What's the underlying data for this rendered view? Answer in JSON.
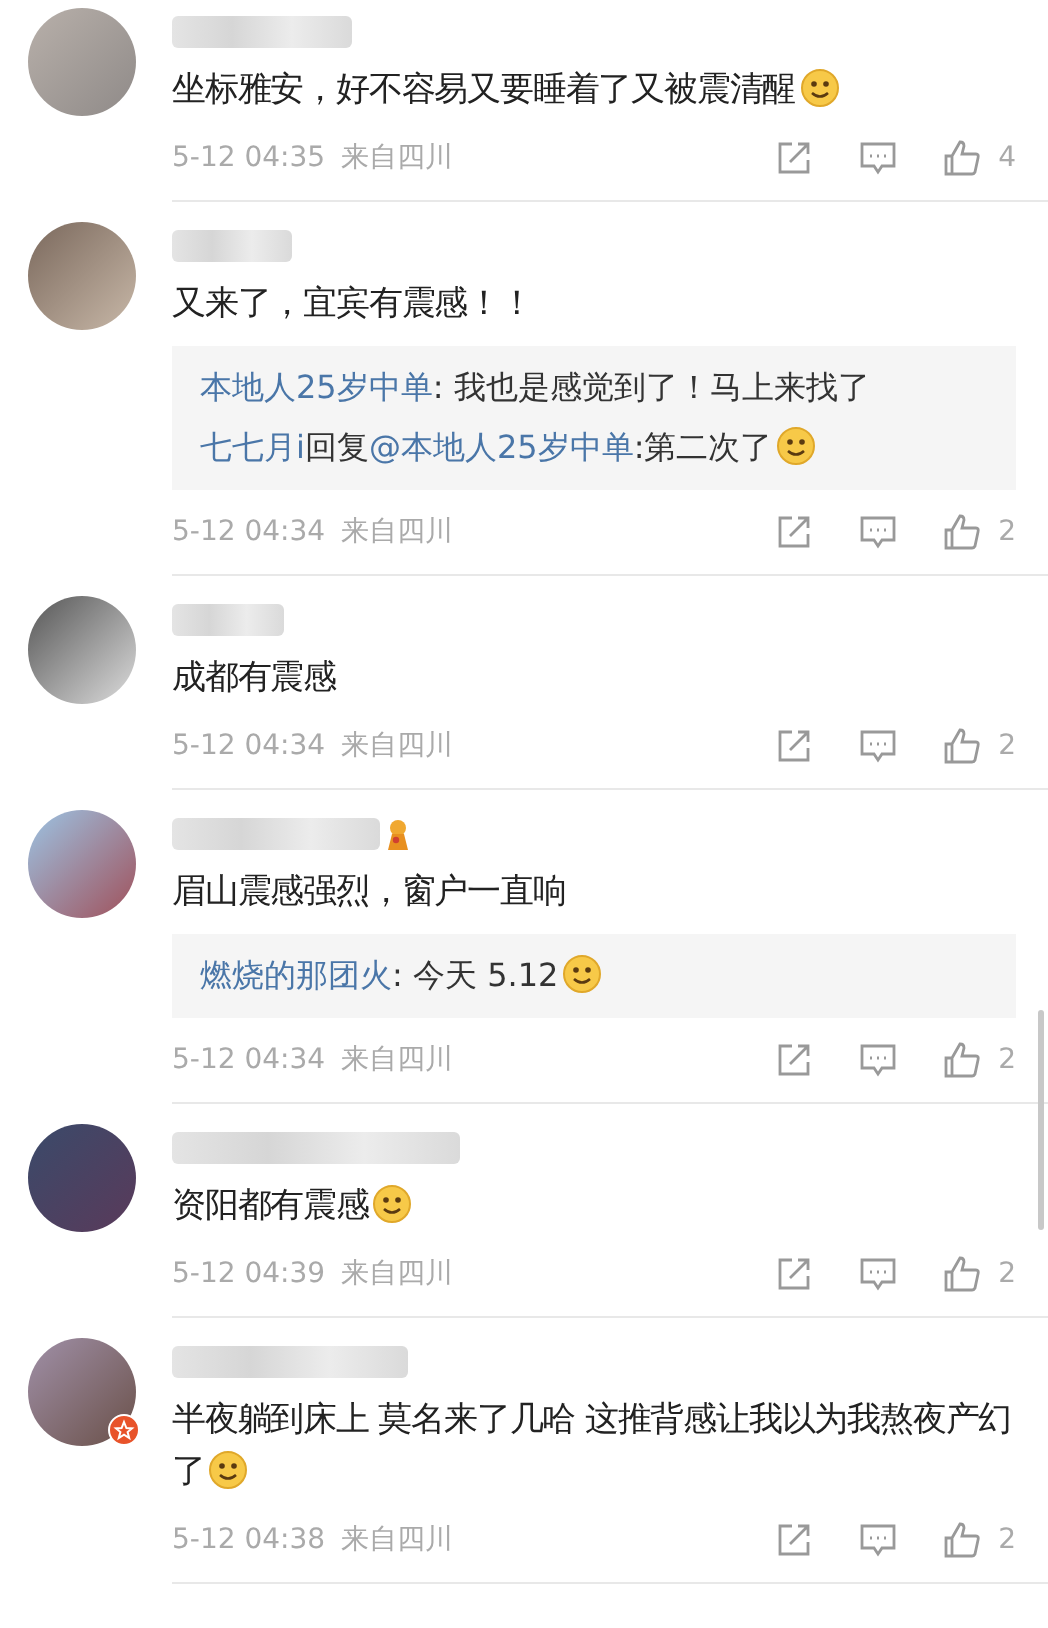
{
  "comments": [
    {
      "text": "坐标雅安，好不容易又要睡着了又被震清醒",
      "emoji": true,
      "name_badge": false,
      "verified": false,
      "time": "5-12 04:35",
      "location": "来自四川",
      "likes": "4"
    },
    {
      "text": "又来了，宜宾有震感！！",
      "emoji": false,
      "name_badge": false,
      "verified": false,
      "time": "5-12 04:34",
      "location": "来自四川",
      "likes": "2",
      "replies": [
        {
          "emoji": false,
          "parts": [
            {
              "text": "本地人25岁中单",
              "link": true
            },
            {
              "text": ": 我也是感觉到了！马上来找了",
              "link": false
            }
          ]
        },
        {
          "emoji": true,
          "parts": [
            {
              "text": "七七月i",
              "link": true
            },
            {
              "text": "回复",
              "link": false
            },
            {
              "text": "@本地人25岁中单",
              "link": true
            },
            {
              "text": ":第二次了",
              "link": false
            }
          ]
        }
      ]
    },
    {
      "text": "成都有震感",
      "emoji": false,
      "name_badge": false,
      "verified": false,
      "time": "5-12 04:34",
      "location": "来自四川",
      "likes": "2"
    },
    {
      "text": "眉山震感强烈，窗户一直响",
      "emoji": false,
      "name_badge": true,
      "verified": false,
      "time": "5-12 04:34",
      "location": "来自四川",
      "likes": "2",
      "replies": [
        {
          "emoji": true,
          "parts": [
            {
              "text": "燃烧的那团火",
              "link": true
            },
            {
              "text": ": 今天 5.12",
              "link": false
            }
          ]
        }
      ]
    },
    {
      "text": "资阳都有震感",
      "emoji": true,
      "name_badge": false,
      "verified": false,
      "time": "5-12 04:39",
      "location": "来自四川",
      "likes": "2"
    },
    {
      "text": "半夜躺到床上 莫名来了几哈 这推背感让我以为我熬夜产幻了",
      "emoji": true,
      "name_badge": false,
      "verified": true,
      "time": "5-12 04:38",
      "location": "来自四川",
      "likes": "2"
    }
  ]
}
